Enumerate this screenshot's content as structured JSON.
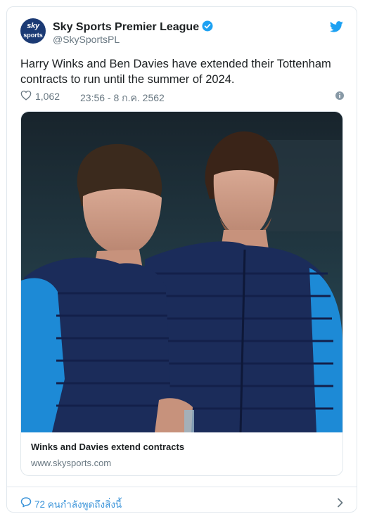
{
  "tweet": {
    "author_name": "Sky Sports Premier League",
    "author_handle": "@SkySportsPL",
    "avatar_text_line1": "sky",
    "avatar_text_line2": "sports",
    "text": "Harry Winks and Ben Davies have extended their Tottenham contracts to run until the summer of 2024.",
    "likes": "1,062",
    "timestamp": "23:56 - 8 ก.ค. 2562"
  },
  "card": {
    "title": "Winks and Davies extend contracts",
    "domain": "www.skysports.com"
  },
  "footer": {
    "reply_text": "72 คนกำลังพูดถึงสิ่งนี้"
  },
  "colors": {
    "brand_blue": "#1da1f2",
    "link_blue": "#3b94d9",
    "muted_text": "#697882",
    "border": "#e1e8ed",
    "avatar_bg": "#1b3a74"
  },
  "icons": [
    "verified-badge-icon",
    "twitter-bird-icon",
    "heart-icon",
    "info-icon",
    "reply-icon",
    "chevron-right-icon"
  ]
}
